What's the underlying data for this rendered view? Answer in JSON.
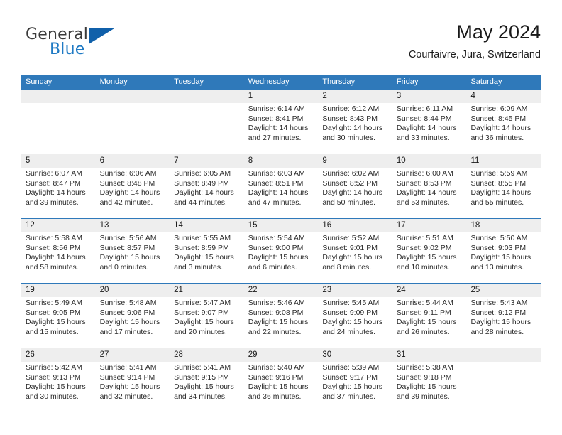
{
  "brand": {
    "name_top": "General",
    "name_bottom": "Blue",
    "accent_color": "#1f7ac4",
    "triangle_color": "#1060aa"
  },
  "header": {
    "title": "May 2024",
    "subtitle": "Courfaivre, Jura, Switzerland"
  },
  "theme": {
    "header_row_bg": "#2f79ba",
    "header_row_text": "#ffffff",
    "daynumber_band_bg": "#eeeeee",
    "row_divider": "#2f79ba"
  },
  "calendar": {
    "weekday_headers": [
      "Sunday",
      "Monday",
      "Tuesday",
      "Wednesday",
      "Thursday",
      "Friday",
      "Saturday"
    ],
    "weeks": [
      [
        {
          "day": "",
          "sunrise": "",
          "sunset": "",
          "daylight_line1": "",
          "daylight_line2": ""
        },
        {
          "day": "",
          "sunrise": "",
          "sunset": "",
          "daylight_line1": "",
          "daylight_line2": ""
        },
        {
          "day": "",
          "sunrise": "",
          "sunset": "",
          "daylight_line1": "",
          "daylight_line2": ""
        },
        {
          "day": "1",
          "sunrise": "Sunrise: 6:14 AM",
          "sunset": "Sunset: 8:41 PM",
          "daylight_line1": "Daylight: 14 hours",
          "daylight_line2": "and 27 minutes."
        },
        {
          "day": "2",
          "sunrise": "Sunrise: 6:12 AM",
          "sunset": "Sunset: 8:43 PM",
          "daylight_line1": "Daylight: 14 hours",
          "daylight_line2": "and 30 minutes."
        },
        {
          "day": "3",
          "sunrise": "Sunrise: 6:11 AM",
          "sunset": "Sunset: 8:44 PM",
          "daylight_line1": "Daylight: 14 hours",
          "daylight_line2": "and 33 minutes."
        },
        {
          "day": "4",
          "sunrise": "Sunrise: 6:09 AM",
          "sunset": "Sunset: 8:45 PM",
          "daylight_line1": "Daylight: 14 hours",
          "daylight_line2": "and 36 minutes."
        }
      ],
      [
        {
          "day": "5",
          "sunrise": "Sunrise: 6:07 AM",
          "sunset": "Sunset: 8:47 PM",
          "daylight_line1": "Daylight: 14 hours",
          "daylight_line2": "and 39 minutes."
        },
        {
          "day": "6",
          "sunrise": "Sunrise: 6:06 AM",
          "sunset": "Sunset: 8:48 PM",
          "daylight_line1": "Daylight: 14 hours",
          "daylight_line2": "and 42 minutes."
        },
        {
          "day": "7",
          "sunrise": "Sunrise: 6:05 AM",
          "sunset": "Sunset: 8:49 PM",
          "daylight_line1": "Daylight: 14 hours",
          "daylight_line2": "and 44 minutes."
        },
        {
          "day": "8",
          "sunrise": "Sunrise: 6:03 AM",
          "sunset": "Sunset: 8:51 PM",
          "daylight_line1": "Daylight: 14 hours",
          "daylight_line2": "and 47 minutes."
        },
        {
          "day": "9",
          "sunrise": "Sunrise: 6:02 AM",
          "sunset": "Sunset: 8:52 PM",
          "daylight_line1": "Daylight: 14 hours",
          "daylight_line2": "and 50 minutes."
        },
        {
          "day": "10",
          "sunrise": "Sunrise: 6:00 AM",
          "sunset": "Sunset: 8:53 PM",
          "daylight_line1": "Daylight: 14 hours",
          "daylight_line2": "and 53 minutes."
        },
        {
          "day": "11",
          "sunrise": "Sunrise: 5:59 AM",
          "sunset": "Sunset: 8:55 PM",
          "daylight_line1": "Daylight: 14 hours",
          "daylight_line2": "and 55 minutes."
        }
      ],
      [
        {
          "day": "12",
          "sunrise": "Sunrise: 5:58 AM",
          "sunset": "Sunset: 8:56 PM",
          "daylight_line1": "Daylight: 14 hours",
          "daylight_line2": "and 58 minutes."
        },
        {
          "day": "13",
          "sunrise": "Sunrise: 5:56 AM",
          "sunset": "Sunset: 8:57 PM",
          "daylight_line1": "Daylight: 15 hours",
          "daylight_line2": "and 0 minutes."
        },
        {
          "day": "14",
          "sunrise": "Sunrise: 5:55 AM",
          "sunset": "Sunset: 8:59 PM",
          "daylight_line1": "Daylight: 15 hours",
          "daylight_line2": "and 3 minutes."
        },
        {
          "day": "15",
          "sunrise": "Sunrise: 5:54 AM",
          "sunset": "Sunset: 9:00 PM",
          "daylight_line1": "Daylight: 15 hours",
          "daylight_line2": "and 6 minutes."
        },
        {
          "day": "16",
          "sunrise": "Sunrise: 5:52 AM",
          "sunset": "Sunset: 9:01 PM",
          "daylight_line1": "Daylight: 15 hours",
          "daylight_line2": "and 8 minutes."
        },
        {
          "day": "17",
          "sunrise": "Sunrise: 5:51 AM",
          "sunset": "Sunset: 9:02 PM",
          "daylight_line1": "Daylight: 15 hours",
          "daylight_line2": "and 10 minutes."
        },
        {
          "day": "18",
          "sunrise": "Sunrise: 5:50 AM",
          "sunset": "Sunset: 9:03 PM",
          "daylight_line1": "Daylight: 15 hours",
          "daylight_line2": "and 13 minutes."
        }
      ],
      [
        {
          "day": "19",
          "sunrise": "Sunrise: 5:49 AM",
          "sunset": "Sunset: 9:05 PM",
          "daylight_line1": "Daylight: 15 hours",
          "daylight_line2": "and 15 minutes."
        },
        {
          "day": "20",
          "sunrise": "Sunrise: 5:48 AM",
          "sunset": "Sunset: 9:06 PM",
          "daylight_line1": "Daylight: 15 hours",
          "daylight_line2": "and 17 minutes."
        },
        {
          "day": "21",
          "sunrise": "Sunrise: 5:47 AM",
          "sunset": "Sunset: 9:07 PM",
          "daylight_line1": "Daylight: 15 hours",
          "daylight_line2": "and 20 minutes."
        },
        {
          "day": "22",
          "sunrise": "Sunrise: 5:46 AM",
          "sunset": "Sunset: 9:08 PM",
          "daylight_line1": "Daylight: 15 hours",
          "daylight_line2": "and 22 minutes."
        },
        {
          "day": "23",
          "sunrise": "Sunrise: 5:45 AM",
          "sunset": "Sunset: 9:09 PM",
          "daylight_line1": "Daylight: 15 hours",
          "daylight_line2": "and 24 minutes."
        },
        {
          "day": "24",
          "sunrise": "Sunrise: 5:44 AM",
          "sunset": "Sunset: 9:11 PM",
          "daylight_line1": "Daylight: 15 hours",
          "daylight_line2": "and 26 minutes."
        },
        {
          "day": "25",
          "sunrise": "Sunrise: 5:43 AM",
          "sunset": "Sunset: 9:12 PM",
          "daylight_line1": "Daylight: 15 hours",
          "daylight_line2": "and 28 minutes."
        }
      ],
      [
        {
          "day": "26",
          "sunrise": "Sunrise: 5:42 AM",
          "sunset": "Sunset: 9:13 PM",
          "daylight_line1": "Daylight: 15 hours",
          "daylight_line2": "and 30 minutes."
        },
        {
          "day": "27",
          "sunrise": "Sunrise: 5:41 AM",
          "sunset": "Sunset: 9:14 PM",
          "daylight_line1": "Daylight: 15 hours",
          "daylight_line2": "and 32 minutes."
        },
        {
          "day": "28",
          "sunrise": "Sunrise: 5:41 AM",
          "sunset": "Sunset: 9:15 PM",
          "daylight_line1": "Daylight: 15 hours",
          "daylight_line2": "and 34 minutes."
        },
        {
          "day": "29",
          "sunrise": "Sunrise: 5:40 AM",
          "sunset": "Sunset: 9:16 PM",
          "daylight_line1": "Daylight: 15 hours",
          "daylight_line2": "and 36 minutes."
        },
        {
          "day": "30",
          "sunrise": "Sunrise: 5:39 AM",
          "sunset": "Sunset: 9:17 PM",
          "daylight_line1": "Daylight: 15 hours",
          "daylight_line2": "and 37 minutes."
        },
        {
          "day": "31",
          "sunrise": "Sunrise: 5:38 AM",
          "sunset": "Sunset: 9:18 PM",
          "daylight_line1": "Daylight: 15 hours",
          "daylight_line2": "and 39 minutes."
        },
        {
          "day": "",
          "sunrise": "",
          "sunset": "",
          "daylight_line1": "",
          "daylight_line2": ""
        }
      ]
    ]
  }
}
